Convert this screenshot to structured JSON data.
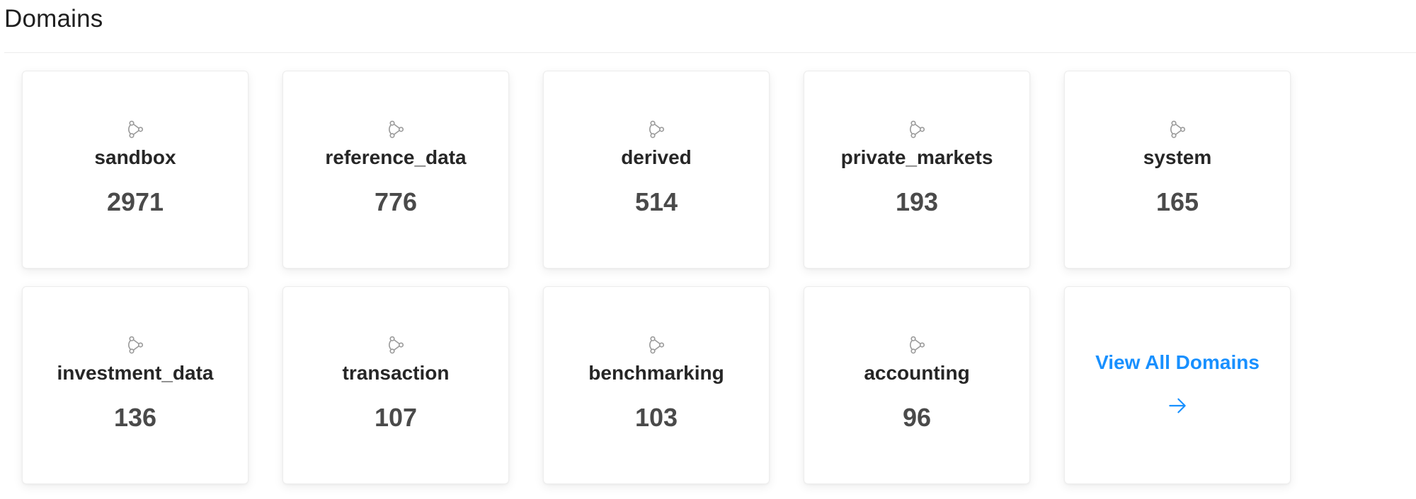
{
  "header": {
    "title": "Domains"
  },
  "domains": [
    {
      "name": "sandbox",
      "count": "2971"
    },
    {
      "name": "reference_data",
      "count": "776"
    },
    {
      "name": "derived",
      "count": "514"
    },
    {
      "name": "private_markets",
      "count": "193"
    },
    {
      "name": "system",
      "count": "165"
    },
    {
      "name": "investment_data",
      "count": "136"
    },
    {
      "name": "transaction",
      "count": "107"
    },
    {
      "name": "benchmarking",
      "count": "103"
    },
    {
      "name": "accounting",
      "count": "96"
    }
  ],
  "view_all": {
    "label": "View All Domains",
    "icon": "arrow-right-icon"
  },
  "icons": {
    "domain": "domain-icon"
  },
  "colors": {
    "accent": "#1890ff",
    "title_text": "#262626",
    "count_text": "#4a4a4a",
    "icon_stroke": "#9a9a9a"
  }
}
